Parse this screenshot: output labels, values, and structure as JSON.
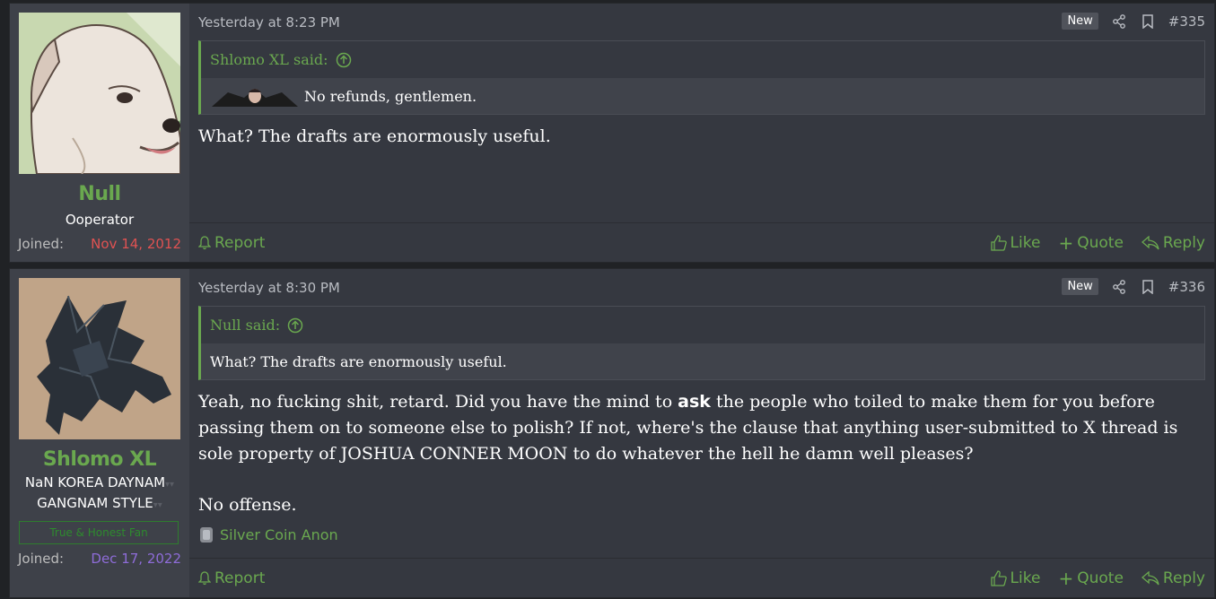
{
  "posts": [
    {
      "user": {
        "name": "Null",
        "title": "Ooperator",
        "joined_label": "Joined:",
        "joined_date": "Nov 14, 2012",
        "joined_color": "#e05252"
      },
      "date": "Yesterday at 8:23 PM",
      "badge": "New",
      "post_number": "#335",
      "quote": {
        "author": "Shlomo XL said:",
        "text": "No refunds, gentlemen."
      },
      "content": "What? The drafts are enormously useful.",
      "footer": {
        "report": "Report",
        "like": "Like",
        "quote": "Quote",
        "reply": "Reply"
      }
    },
    {
      "user": {
        "name": "Shlomo XL",
        "title_line1": "NaN KOREA DAYNAM",
        "title_line2": "GANGNAM STYLE",
        "banner": "True & Honest Fan",
        "joined_label": "Joined:",
        "joined_date": "Dec 17, 2022",
        "joined_color": "#8e6cd8"
      },
      "date": "Yesterday at 8:30 PM",
      "badge": "New",
      "post_number": "#336",
      "quote": {
        "author": "Null said:",
        "text": "What? The drafts are enormously useful."
      },
      "content": {
        "p1_before": "Yeah, no fucking shit, retard. Did you have the mind to ",
        "p1_bold": "ask",
        "p1_after": " the people who toiled to make them for you before passing them on to someone else to polish? If not, where's the clause that anything user-submitted to X thread is sole property of JOSHUA CONNER MOON to do whatever the hell he damn well pleases?",
        "p2": "No offense."
      },
      "trophy": "Silver Coin Anon",
      "footer": {
        "report": "Report",
        "like": "Like",
        "quote": "Quote",
        "reply": "Reply"
      }
    }
  ],
  "colors": {
    "accent": "#6aa84f",
    "background": "#353840",
    "sidebar": "#3e4149"
  }
}
